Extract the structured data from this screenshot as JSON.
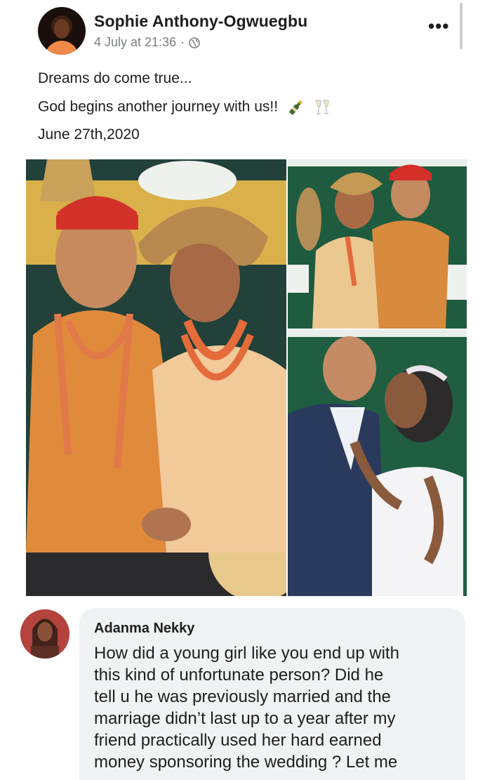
{
  "post": {
    "author": "Sophie Anthony-Ogwuegbu",
    "timestamp": "4 July at 21:36",
    "separator": "·",
    "privacy_icon": "globe-icon",
    "more_icon": "more-options-icon",
    "more_label": "•••",
    "lines": [
      "Dreams do come true...",
      "God begins another journey with us!!",
      "June 27th,2020"
    ],
    "emojis": [
      "champagne-bottle-icon",
      "clinking-glasses-icon"
    ],
    "photos": [
      {
        "name": "traditional-wedding-photo-main"
      },
      {
        "name": "traditional-wedding-photo-standing"
      },
      {
        "name": "white-wedding-photo-kiss"
      }
    ]
  },
  "comment": {
    "author": "Adanma Nekky",
    "lines": [
      "How did a young girl like you end up with",
      "this kind of unfortunate person? Did he",
      "tell u he was previously married and the",
      "marriage didn’t last up to a year after my",
      "friend practically used her hard earned",
      "money sponsoring the wedding ? Let me"
    ]
  },
  "colors": {
    "text": "#1c1e21",
    "meta": "#7a7d82",
    "bubble": "#f0f2f5"
  }
}
